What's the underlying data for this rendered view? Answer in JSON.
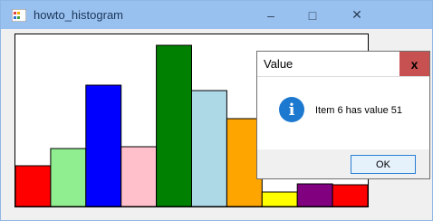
{
  "window": {
    "title": "howto_histogram",
    "minimize_glyph": "–",
    "maximize_glyph": "□",
    "close_glyph": "✕"
  },
  "chart_data": {
    "type": "bar",
    "values": [
      45,
      64,
      134,
      66,
      178,
      128,
      97,
      16,
      25,
      24
    ],
    "colors": [
      "#ff0000",
      "#90ee90",
      "#0000ff",
      "#ffc0cb",
      "#008000",
      "#add8e6",
      "#ffa500",
      "#ffff00",
      "#800080",
      "#ff0000"
    ],
    "ylim": [
      0,
      190
    ]
  },
  "dialog": {
    "title": "Value",
    "close_glyph": "x",
    "icon_glyph": "i",
    "message": "Item 6 has value 51",
    "ok_label": "OK"
  }
}
